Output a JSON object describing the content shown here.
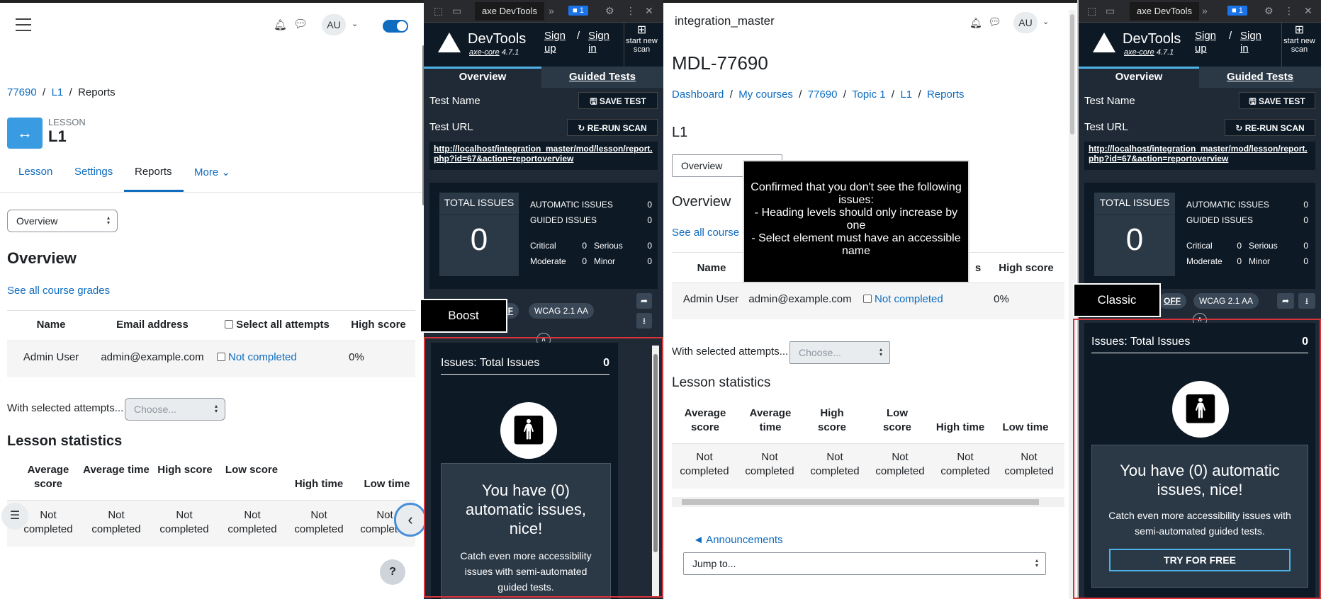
{
  "left": {
    "user_initials": "AU",
    "breadcrumb": [
      "77690",
      "L1",
      "Reports"
    ],
    "module_type": "LESSON",
    "title": "L1",
    "tabs": [
      "Lesson",
      "Settings",
      "Reports",
      "More"
    ],
    "select_value": "Overview",
    "heading": "Overview",
    "grades_link": "See all course grades",
    "table_headers": [
      "Name",
      "Email address",
      "Select all attempts",
      "High score"
    ],
    "row": {
      "name": "Admin User",
      "email": "admin@example.com",
      "status": "Not completed",
      "score": "0%"
    },
    "with_selected": "With selected attempts...",
    "choose": "Choose...",
    "stats_title": "Lesson statistics",
    "stats_headers": [
      "Average score",
      "Average time",
      "High score",
      "Low score",
      "High time",
      "Low time"
    ],
    "stats_value": "Not completed",
    "help": "?"
  },
  "right": {
    "site_name": "integration_master",
    "user_initials": "AU",
    "page_title": "MDL-77690",
    "breadcrumb": [
      "Dashboard",
      "My courses",
      "77690",
      "Topic 1",
      "L1",
      "Reports"
    ],
    "subtitle": "L1",
    "select_value": "Overview",
    "heading": "Overview",
    "grades_link": "See all course g",
    "table_headers": [
      "Name",
      "s",
      "High score"
    ],
    "row": {
      "name": "Admin User",
      "email": "admin@example.com",
      "status": "Not completed",
      "score": "0%"
    },
    "with_selected": "With selected attempts...",
    "choose": "Choose...",
    "stats_title": "Lesson statistics",
    "stats_headers": [
      "Average score",
      "Average time",
      "High score",
      "Low score",
      "High time",
      "Low time"
    ],
    "stats_value": "Not completed",
    "announcements": "◄ Announcements",
    "jump_to": "Jump to..."
  },
  "axe": {
    "devtools_tab": "axe DevTools",
    "issues_badge": "1",
    "brand": "DevTools",
    "core": "axe-core",
    "version": "4.7.1",
    "sign_up": "Sign up",
    "sign_in": "Sign in",
    "new_scan": "start new scan",
    "tab_overview": "Overview",
    "tab_guided": "Guided Tests",
    "test_name": "Test Name",
    "save_test": "SAVE TEST",
    "test_url": "Test URL",
    "rerun": "RE-RUN SCAN",
    "url": "http://localhost/integration_master/mod/lesson/report.php?id=67&action=reportoverview",
    "total_issues": "TOTAL ISSUES",
    "total": "0",
    "automatic": "AUTOMATIC ISSUES",
    "automatic_val": "0",
    "guided": "GUIDED ISSUES",
    "guided_val": "0",
    "critical": "Critical",
    "critical_val": "0",
    "serious": "Serious",
    "serious_val": "0",
    "moderate": "Moderate",
    "moderate_val": "0",
    "minor": "Minor",
    "minor_val": "0",
    "off": "OFF",
    "wcag": "WCAG 2.1 AA",
    "issues_title": "Issues: Total Issues",
    "issues_count": "0",
    "nice": "You have (0) automatic issues, nice!",
    "catch": "Catch even more accessibility issues with semi-automated guided tests.",
    "try": "TRY FOR FREE"
  },
  "labels": {
    "boost": "Boost",
    "classic": "Classic",
    "tooltip": "Confirmed that you don't see the following issues:\n- Heading levels should only increase by one\n- Select element must have an accessible name"
  },
  "colors": {
    "accent": "#0f6cbf",
    "axe_bg": "#1f2a36",
    "axe_dark": "#0d1a26",
    "highlight": "#d9343a",
    "tab_line": "#4fb3e8"
  }
}
